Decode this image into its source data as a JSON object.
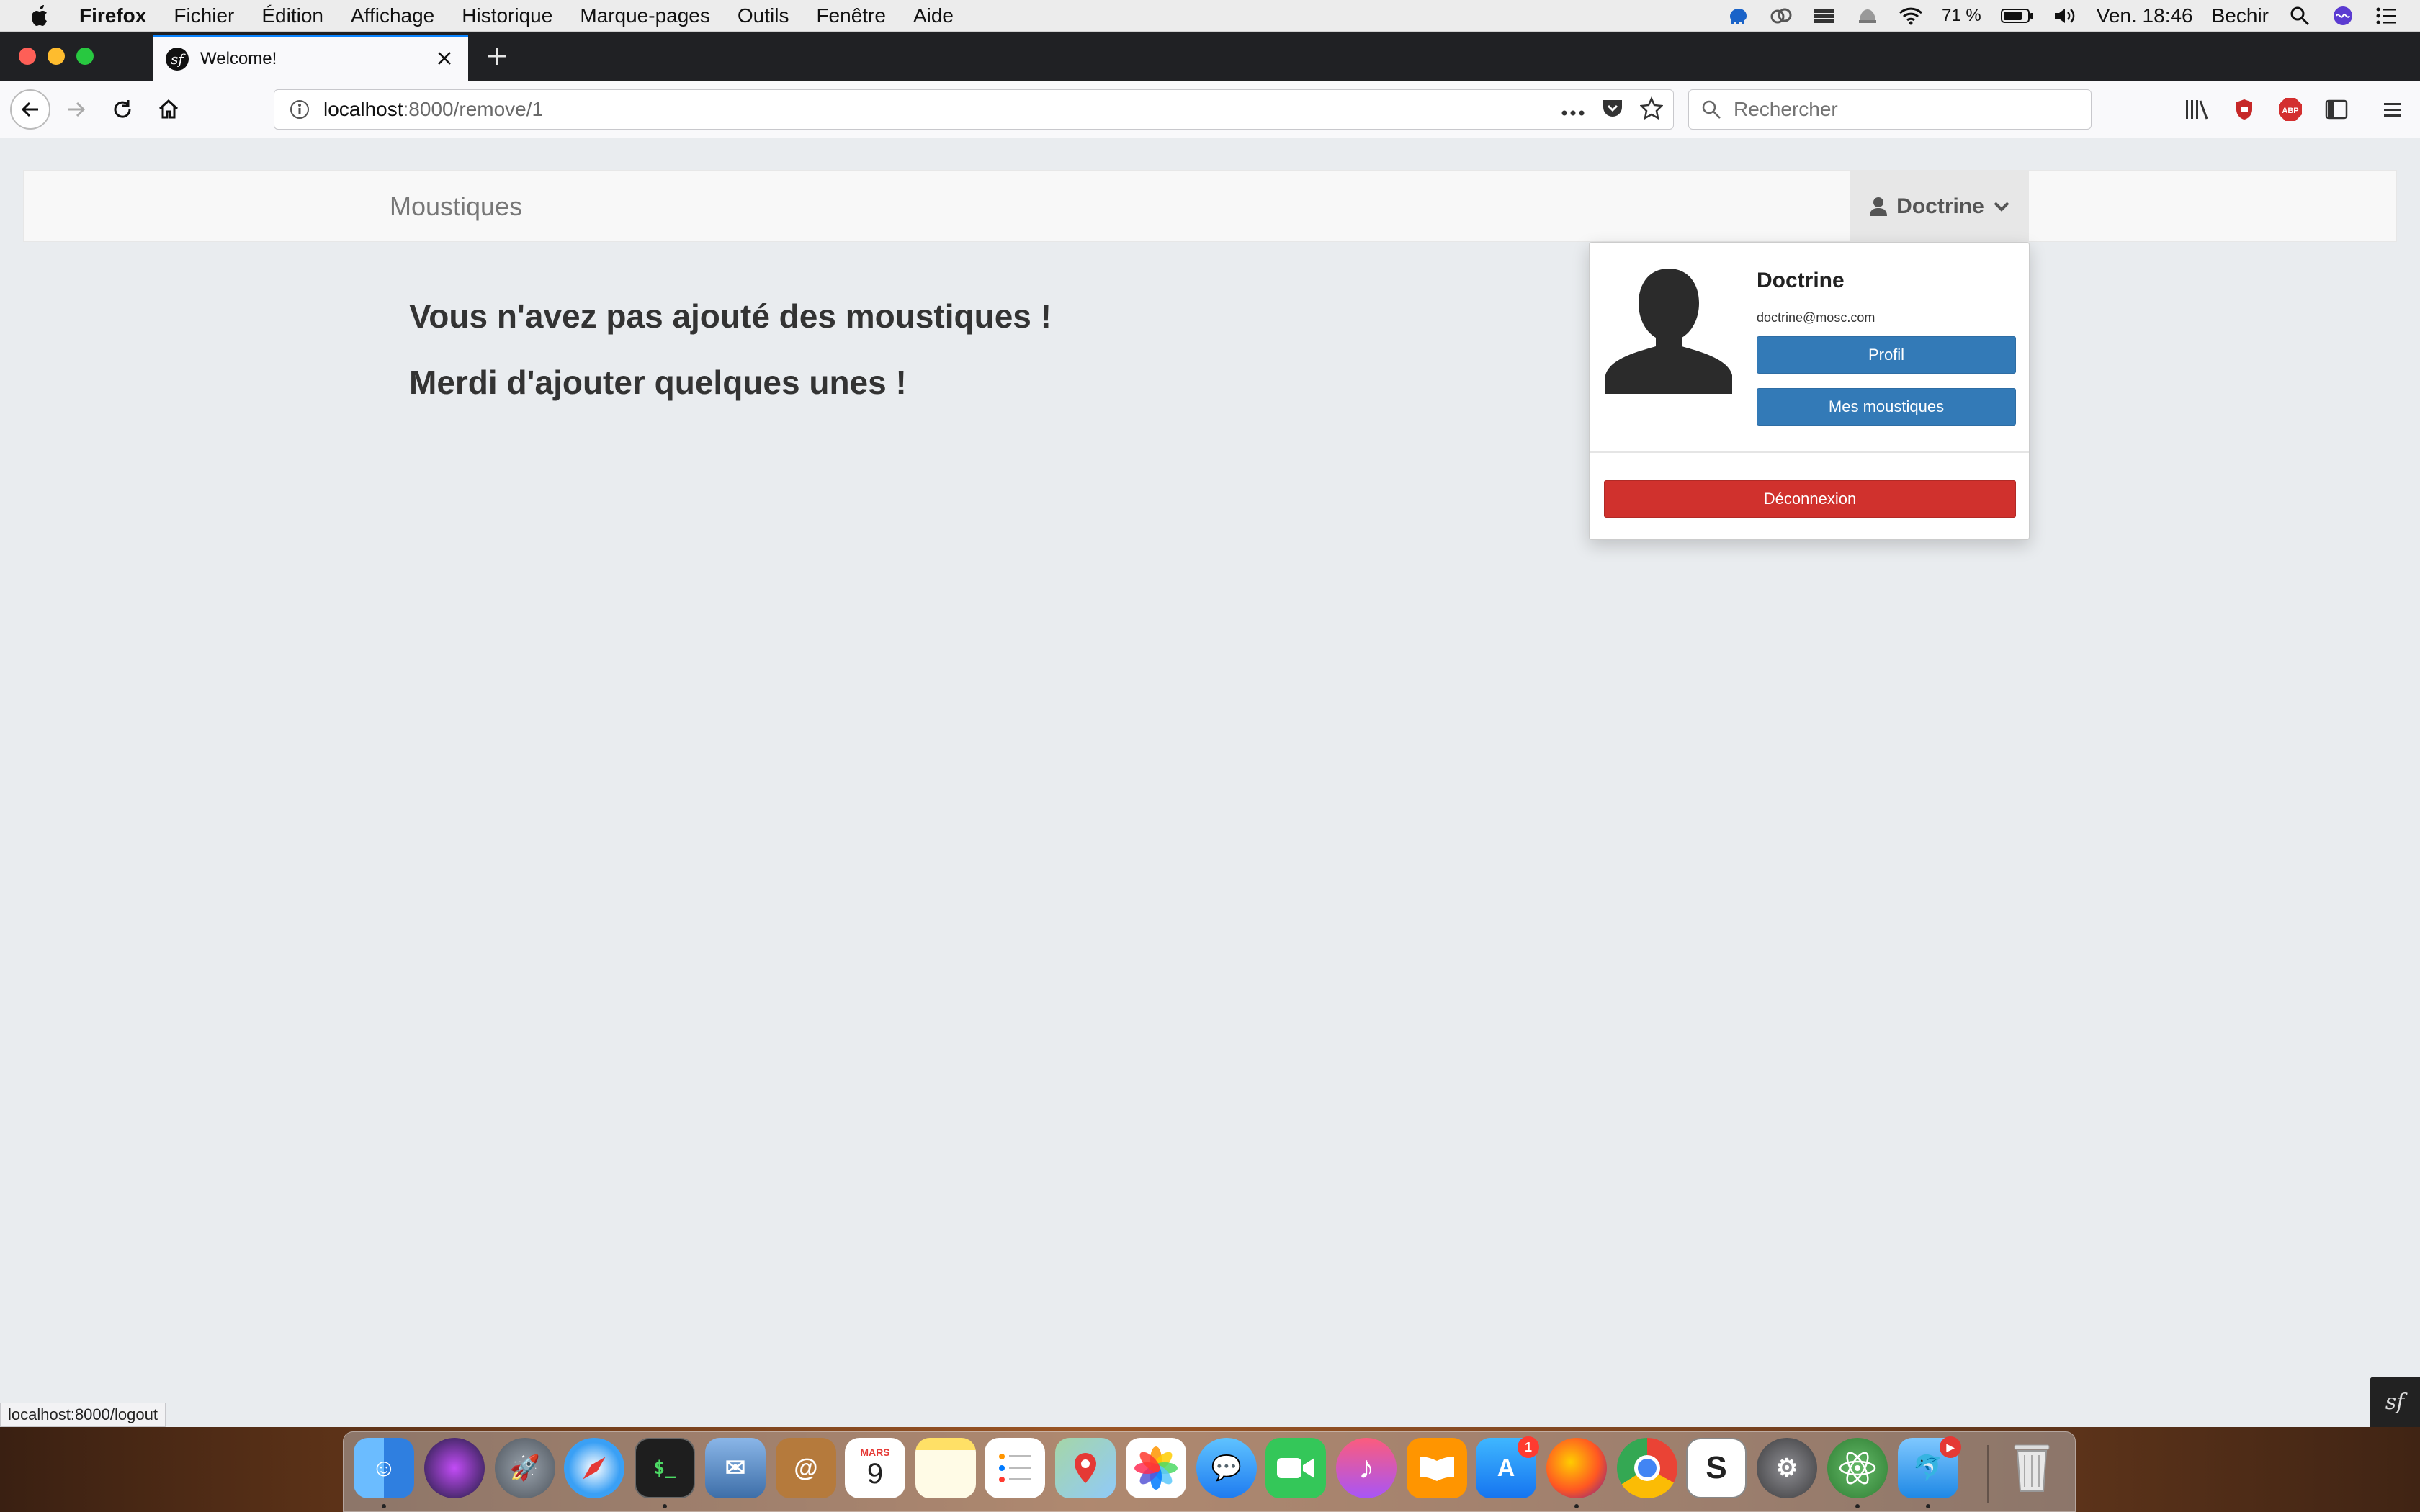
{
  "menubar": {
    "app_name": "Firefox",
    "items": [
      "Fichier",
      "Édition",
      "Affichage",
      "Historique",
      "Marque-pages",
      "Outils",
      "Fenêtre",
      "Aide"
    ],
    "battery": "71 %",
    "clock": "Ven. 18:46",
    "user": "Bechir"
  },
  "browser": {
    "tab_title": "Welcome!",
    "url_host": "localhost",
    "url_path": ":8000/remove/1",
    "search_placeholder": "Rechercher",
    "status_url": "localhost:8000/logout"
  },
  "site": {
    "brand": "Moustiques",
    "user_menu_label": "Doctrine",
    "heading_line1": "Vous n'avez pas ajouté des moustiques !",
    "heading_line2": "Merdi d'ajouter quelques unes !",
    "dropdown": {
      "name": "Doctrine",
      "email": "doctrine@mosc.com",
      "profile_button": "Profil",
      "my_mosquitoes_button": "Mes moustiques",
      "logout_button": "Déconnexion"
    }
  },
  "dock": {
    "calendar_month": "MARS",
    "calendar_day": "9",
    "appstore_badge": "1"
  },
  "colors": {
    "primary": "#337ab7",
    "danger": "#d0312d",
    "page_bg": "#e9ecef"
  }
}
